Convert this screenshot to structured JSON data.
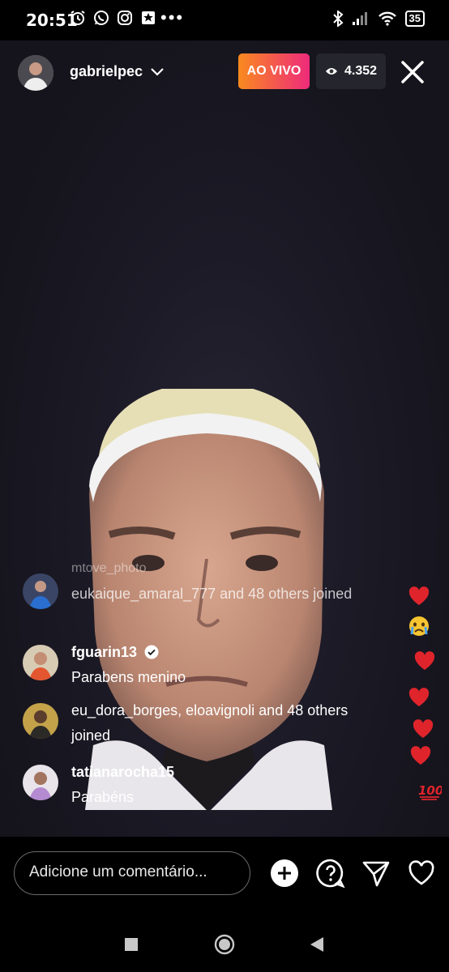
{
  "status_bar": {
    "time": "20:51",
    "left_icons": [
      "alarm-icon",
      "whatsapp-icon",
      "instagram-icon",
      "news-icon"
    ],
    "more": "•••",
    "battery": "35"
  },
  "live": {
    "username": "gabrielpec",
    "live_badge": "AO VIVO",
    "viewer_count": "4.352"
  },
  "comments": [
    {
      "text": "mtove_photo",
      "faded": true
    },
    {
      "text": "eukaique_amaral_777 and 48 others joined"
    },
    {
      "name": "fguarin13",
      "verified": true,
      "text": "Parabens menino"
    },
    {
      "text": "eu_dora_borges, eloavignoli and 48 others joined"
    },
    {
      "name": "tatianarocha15",
      "text": "Parabéns"
    }
  ],
  "reactions": [
    "heart",
    "crying-face",
    "heart",
    "heart",
    "heart",
    "heart",
    "hundred"
  ],
  "composer": {
    "placeholder": "Adicione um comentário..."
  },
  "colors": {
    "live_gradient_start": "#f98a1f",
    "live_gradient_end": "#ee2a7b",
    "heart": "#e0242c"
  }
}
